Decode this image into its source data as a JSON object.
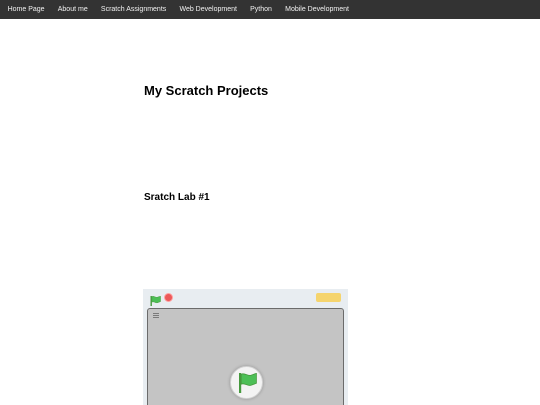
{
  "nav": {
    "items": [
      {
        "label": "Home Page"
      },
      {
        "label": "About me"
      },
      {
        "label": "Scratch Assignments"
      },
      {
        "label": "Web Development"
      },
      {
        "label": "Python"
      },
      {
        "label": "Mobile Development"
      }
    ]
  },
  "main": {
    "page_title": "My Scratch Projects",
    "section_title": "Sratch Lab #1"
  },
  "player": {
    "icons": {
      "green_flag": "green-flag-icon",
      "stop": "stop-icon",
      "turbo": "turbo-mode-icon",
      "stage_menu": "menu-icon",
      "start": "green-flag-icon"
    }
  },
  "colors": {
    "nav_background": "#333333",
    "nav_text": "#f2f2f2",
    "flag_green": "#4cbf56",
    "stop_red": "#ec5959",
    "stage_gray": "#c4c4c4",
    "player_bar": "#e8edf1"
  }
}
